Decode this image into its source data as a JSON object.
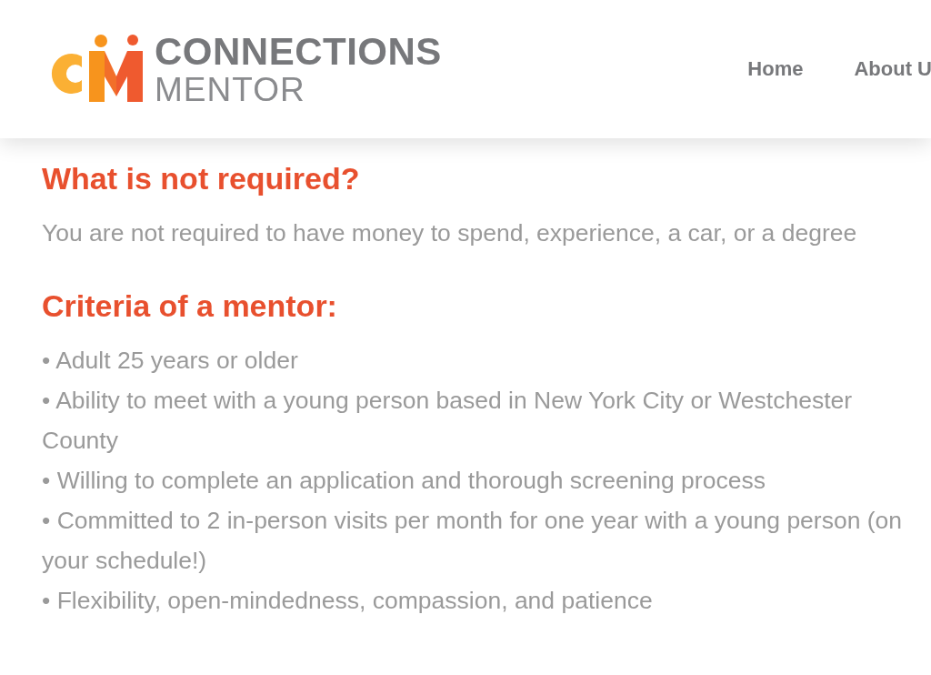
{
  "header": {
    "logo": {
      "line_1": "CONNECTIONS",
      "line_2": "MENTOR"
    },
    "nav": [
      {
        "label": "Home"
      },
      {
        "label": "About U"
      }
    ]
  },
  "sections": [
    {
      "heading": "What is not required?",
      "paragraphs": [
        "You are not required to have money to spend, experience, a car, or a degree"
      ]
    },
    {
      "heading": "Criteria of a mentor:",
      "paragraphs": [
        "• Adult 25 years or older",
        "• Ability to meet with a young person based in New York City or Westchester County",
        "• Willing to complete an application and thorough screening process",
        "• Committed to 2 in-person visits per month for one year with a young person (on your schedule!)",
        "• Flexibility, open-mindedness, compassion, and patience"
      ]
    }
  ]
}
